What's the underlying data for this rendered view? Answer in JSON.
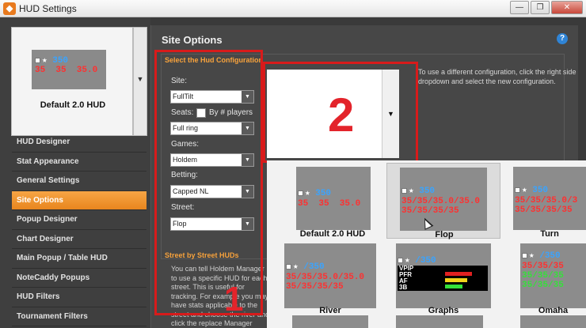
{
  "window": {
    "app_icon": "holdem-manager-icon",
    "title": "HUD Settings",
    "controls": [
      "minimize-icon",
      "restore-icon",
      "close-icon"
    ]
  },
  "hud_card": {
    "label": "Default 2.0 HUD",
    "line1": "350",
    "line2": "35  35  35.0"
  },
  "nav": {
    "items": [
      {
        "label": "HUD Designer",
        "active": false
      },
      {
        "label": "Stat Appearance",
        "active": false
      },
      {
        "label": "General Settings",
        "active": false
      },
      {
        "label": "Site Options",
        "active": true
      },
      {
        "label": "Popup Designer",
        "active": false
      },
      {
        "label": "Chart Designer",
        "active": false
      },
      {
        "label": "Main Popup / Table HUD",
        "active": false
      },
      {
        "label": "NoteCaddy Popups",
        "active": false
      },
      {
        "label": "HUD Filters",
        "active": false
      },
      {
        "label": "Tournament Filters",
        "active": false
      }
    ]
  },
  "panel": {
    "title": "Site Options",
    "help_icon": "help-icon",
    "section1_title": "Select the Hud Configuration",
    "site_label": "Site:",
    "site_value": "FullTilt",
    "seats_label": "Seats:",
    "seats_checkbox_label": "By # players",
    "seats_value": "Full ring",
    "games_label": "Games:",
    "games_value": "Holdem",
    "betting_label": "Betting:",
    "betting_value": "Capped NL",
    "street_label": "Street:",
    "street_value": "Flop",
    "help_text": "To use a different configuration, click the right side dropdown and select the new configuration.",
    "section2_title": "Street by Street HUDs",
    "section2_text": "You can tell Holdem Manager to use a specific HUD for each street. This is useful for tracking. For example you may have stats applicable to the street and choose the river and click the replace Manager detects a river be"
  },
  "annotations": {
    "marker1": "1",
    "marker2": "2"
  },
  "gallery": {
    "tiles": [
      {
        "label": "Default 2.0 HUD",
        "line1": "350",
        "line2": "35  35  35.0"
      },
      {
        "label": "Flop",
        "line1": "350",
        "line2": "35/35/35.0/35.0",
        "line3": "35/35/35/35"
      },
      {
        "label": "Turn",
        "line1": "350",
        "line2": "35/35/35.0/3",
        "line3": "35/35/35/35"
      },
      {
        "label": "River",
        "line1": "/350",
        "line2": "35/35/35.0/35.0",
        "line3": "35/35/35/35"
      },
      {
        "label": "Graphs",
        "line1": "/350",
        "stats": [
          "VPIP",
          "PFR",
          "AF",
          "3B"
        ]
      },
      {
        "label": "Omaha",
        "line1": "/350",
        "line2": "35/35/35",
        "line3": "35/35/35",
        "line4": "35/35/35"
      }
    ]
  },
  "colors": {
    "accent": "#f7a23c",
    "active_nav": "#e8861e",
    "marker": "#e3242b",
    "stat_blue": "#3aa4ff",
    "stat_red": "#ff3030",
    "stat_green": "#35e03a"
  }
}
